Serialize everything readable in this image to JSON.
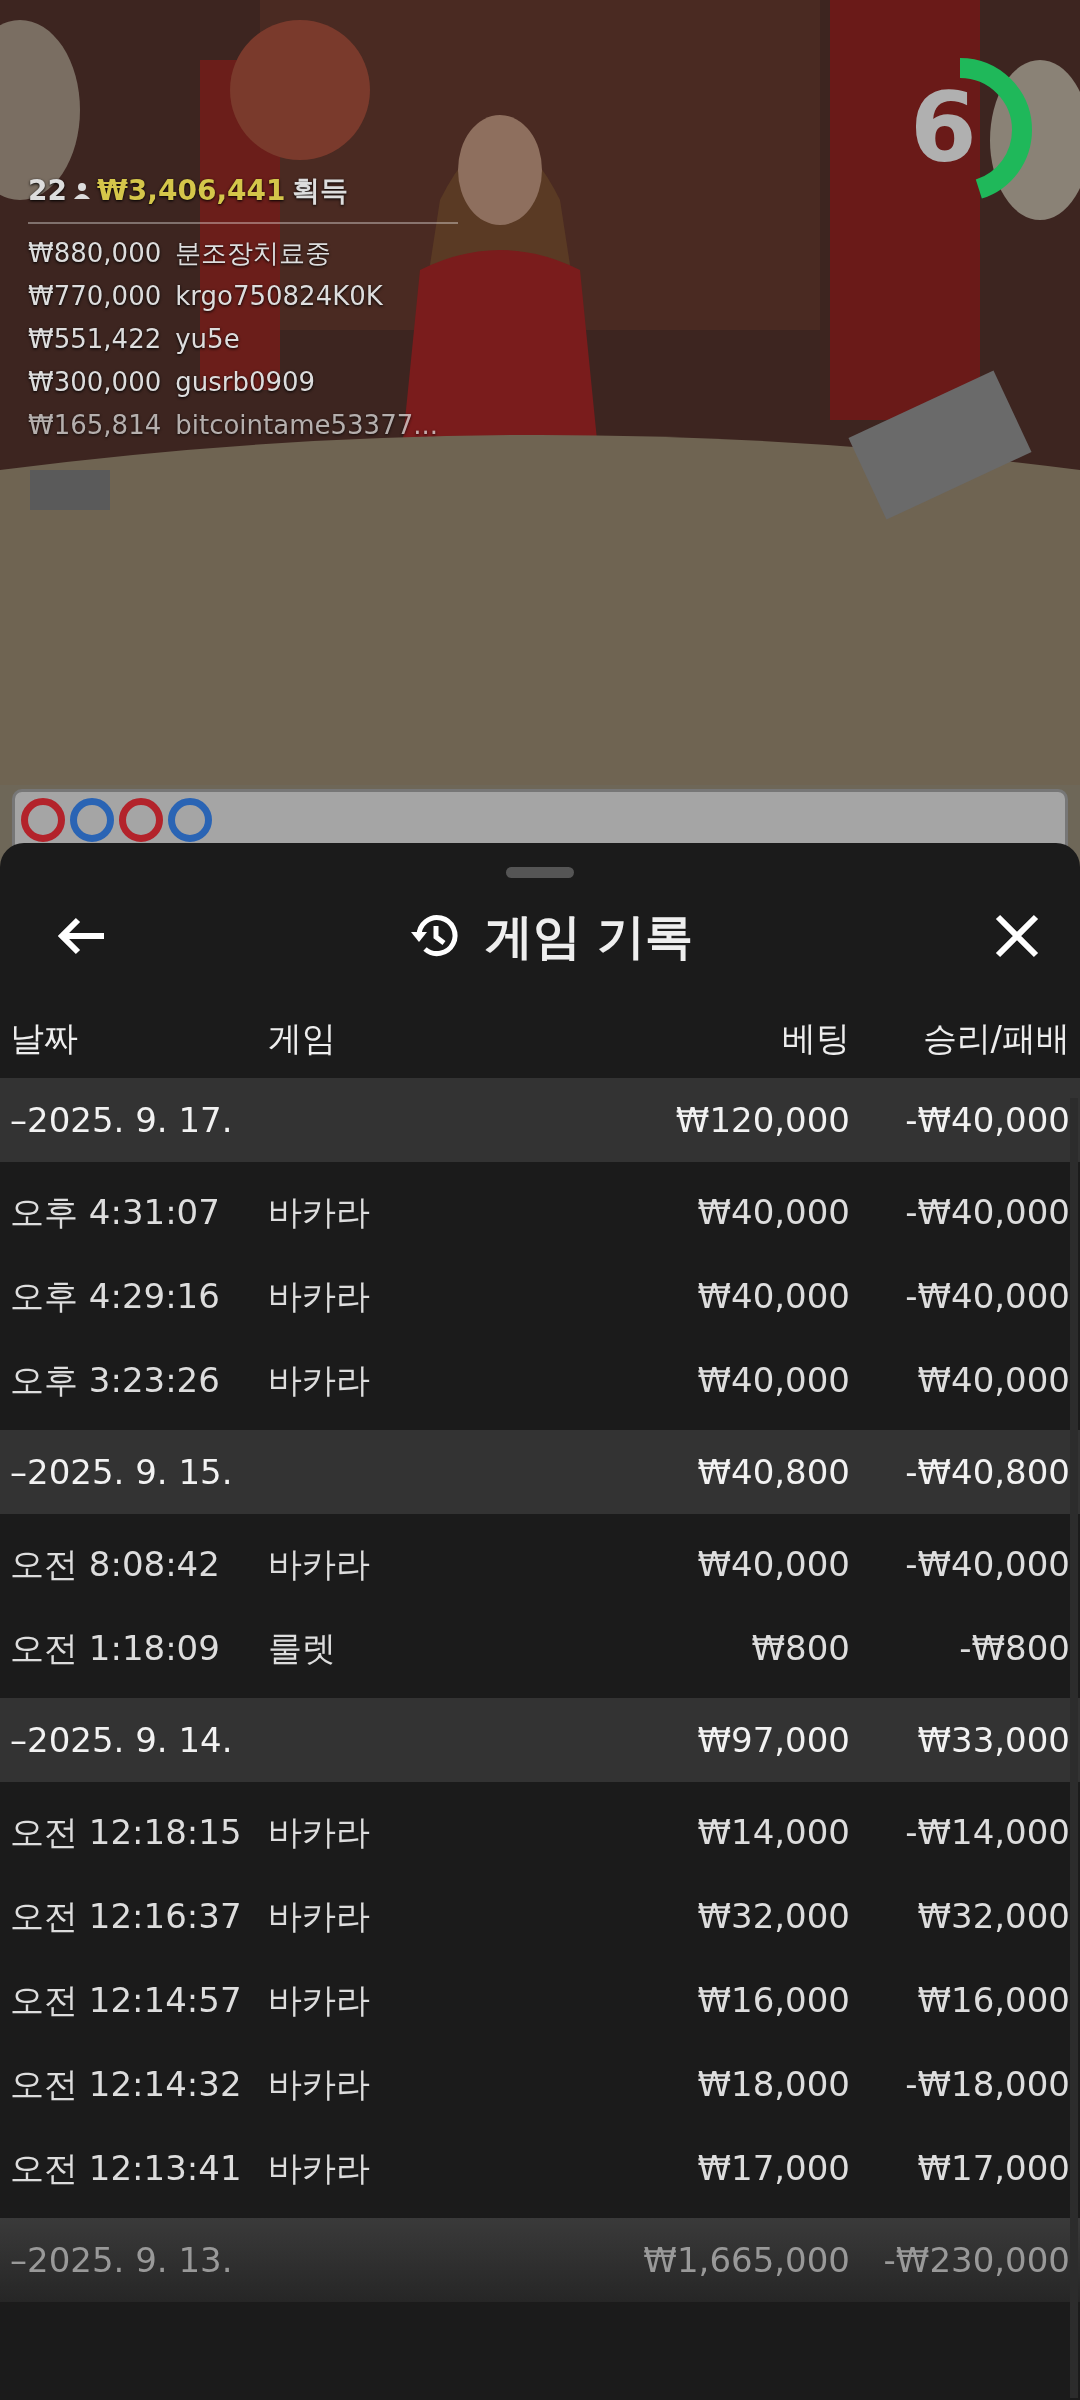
{
  "video": {
    "kind": "picture",
    "players": "22",
    "total": "₩3,406,441",
    "total_label": "획득",
    "winners": [
      {
        "amount": "₩880,000",
        "name": "분조장치료중"
      },
      {
        "amount": "₩770,000",
        "name": "krgo750824K0K"
      },
      {
        "amount": "₩551,422",
        "name": "yu5e"
      },
      {
        "amount": "₩300,000",
        "name": "gusrb0909"
      },
      {
        "amount": "₩165,814",
        "name": "bitcointame53377..."
      }
    ],
    "timer": {
      "value": "6",
      "level": 0.45
    }
  },
  "roadmap": [
    {
      "color": "#b3232b"
    },
    {
      "color": "#2a64b4"
    },
    {
      "color": "#b3232b"
    },
    {
      "color": "#2a64b4"
    }
  ],
  "sheet": {
    "title": "게임 기록",
    "columns": [
      "날짜",
      "게임",
      "베팅",
      "승리/패배"
    ],
    "groups": [
      {
        "date": "–2025. 9. 17.",
        "faded": false,
        "bet": "₩120,000",
        "result": "-₩40,000",
        "rows": [
          {
            "time": "오후 4:31:07",
            "game": "바카라",
            "bet": "₩40,000",
            "result": "-₩40,000"
          },
          {
            "time": "오후 4:29:16",
            "game": "바카라",
            "bet": "₩40,000",
            "result": "-₩40,000"
          },
          {
            "time": "오후 3:23:26",
            "game": "바카라",
            "bet": "₩40,000",
            "result": "₩40,000"
          }
        ]
      },
      {
        "date": "–2025. 9. 15.",
        "faded": false,
        "bet": "₩40,800",
        "result": "-₩40,800",
        "rows": [
          {
            "time": "오전 8:08:42",
            "game": "바카라",
            "bet": "₩40,000",
            "result": "-₩40,000"
          },
          {
            "time": "오전 1:18:09",
            "game": "룰렛",
            "bet": "₩800",
            "result": "-₩800"
          }
        ]
      },
      {
        "date": "–2025. 9. 14.",
        "faded": false,
        "bet": "₩97,000",
        "result": "₩33,000",
        "rows": [
          {
            "time": "오전 12:18:15",
            "game": "바카라",
            "bet": "₩14,000",
            "result": "-₩14,000"
          },
          {
            "time": "오전 12:16:37",
            "game": "바카라",
            "bet": "₩32,000",
            "result": "₩32,000"
          },
          {
            "time": "오전 12:14:57",
            "game": "바카라",
            "bet": "₩16,000",
            "result": "₩16,000"
          },
          {
            "time": "오전 12:14:32",
            "game": "바카라",
            "bet": "₩18,000",
            "result": "-₩18,000"
          },
          {
            "time": "오전 12:13:41",
            "game": "바카라",
            "bet": "₩17,000",
            "result": "₩17,000"
          }
        ]
      },
      {
        "date": "–2025. 9. 13.",
        "faded": true,
        "bet": "₩1,665,000",
        "result": "-₩230,000"
      }
    ]
  }
}
